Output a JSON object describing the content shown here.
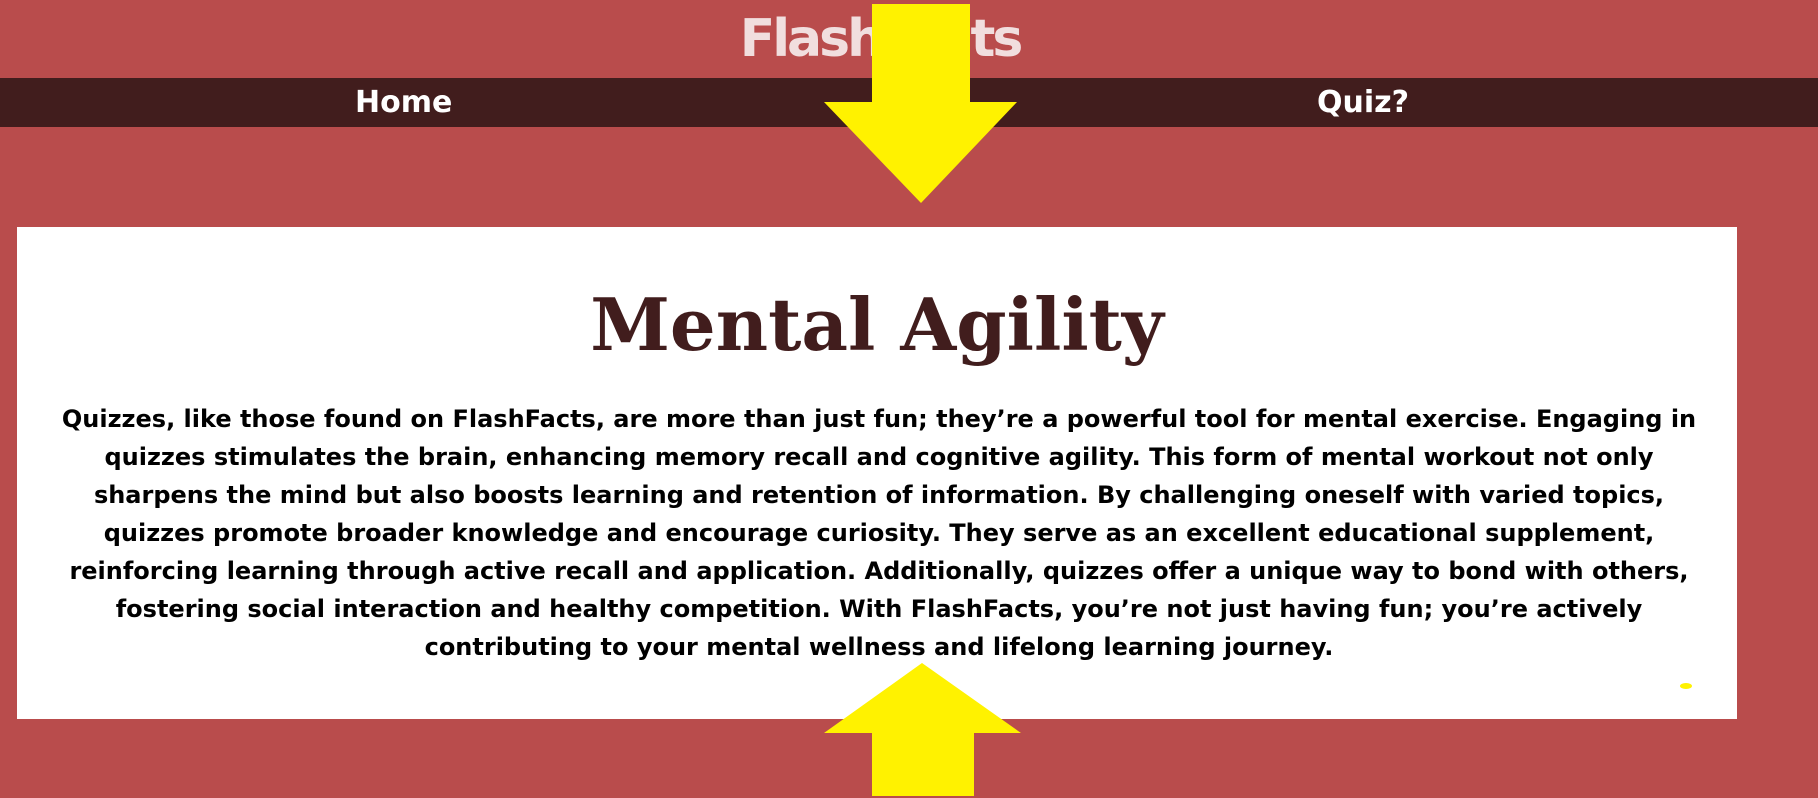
{
  "brand": {
    "title": "FlashFacts"
  },
  "nav": {
    "home_label": "Home",
    "quiz_label": "Quiz?"
  },
  "content": {
    "title": "Mental Agility",
    "body": "Quizzes, like those found on FlashFacts, are more than just fun; they’re a powerful tool for mental exercise. Engaging in quizzes stimulates the brain, enhancing memory recall and cognitive agility. This form of mental workout not only sharpens the mind but also boosts learning and retention of information. By challenging oneself with varied topics, quizzes promote broader knowledge and encourage curiosity. They serve as an excellent educational supplement, reinforcing learning through active recall and application. Additionally, quizzes offer a unique way to bond with others, fostering social interaction and healthy competition. With FlashFacts, you’re not just having fun; you’re actively contributing to your mental wellness and lifelong learning journey."
  },
  "annotations": {
    "arrow_color": "#fff200",
    "items": [
      "arrow-down-icon",
      "arrow-up-icon"
    ]
  },
  "colors": {
    "page_background": "#b94c4c",
    "nav_background": "#411d1d",
    "title_color": "#411d1d",
    "card_background": "#ffffff"
  }
}
